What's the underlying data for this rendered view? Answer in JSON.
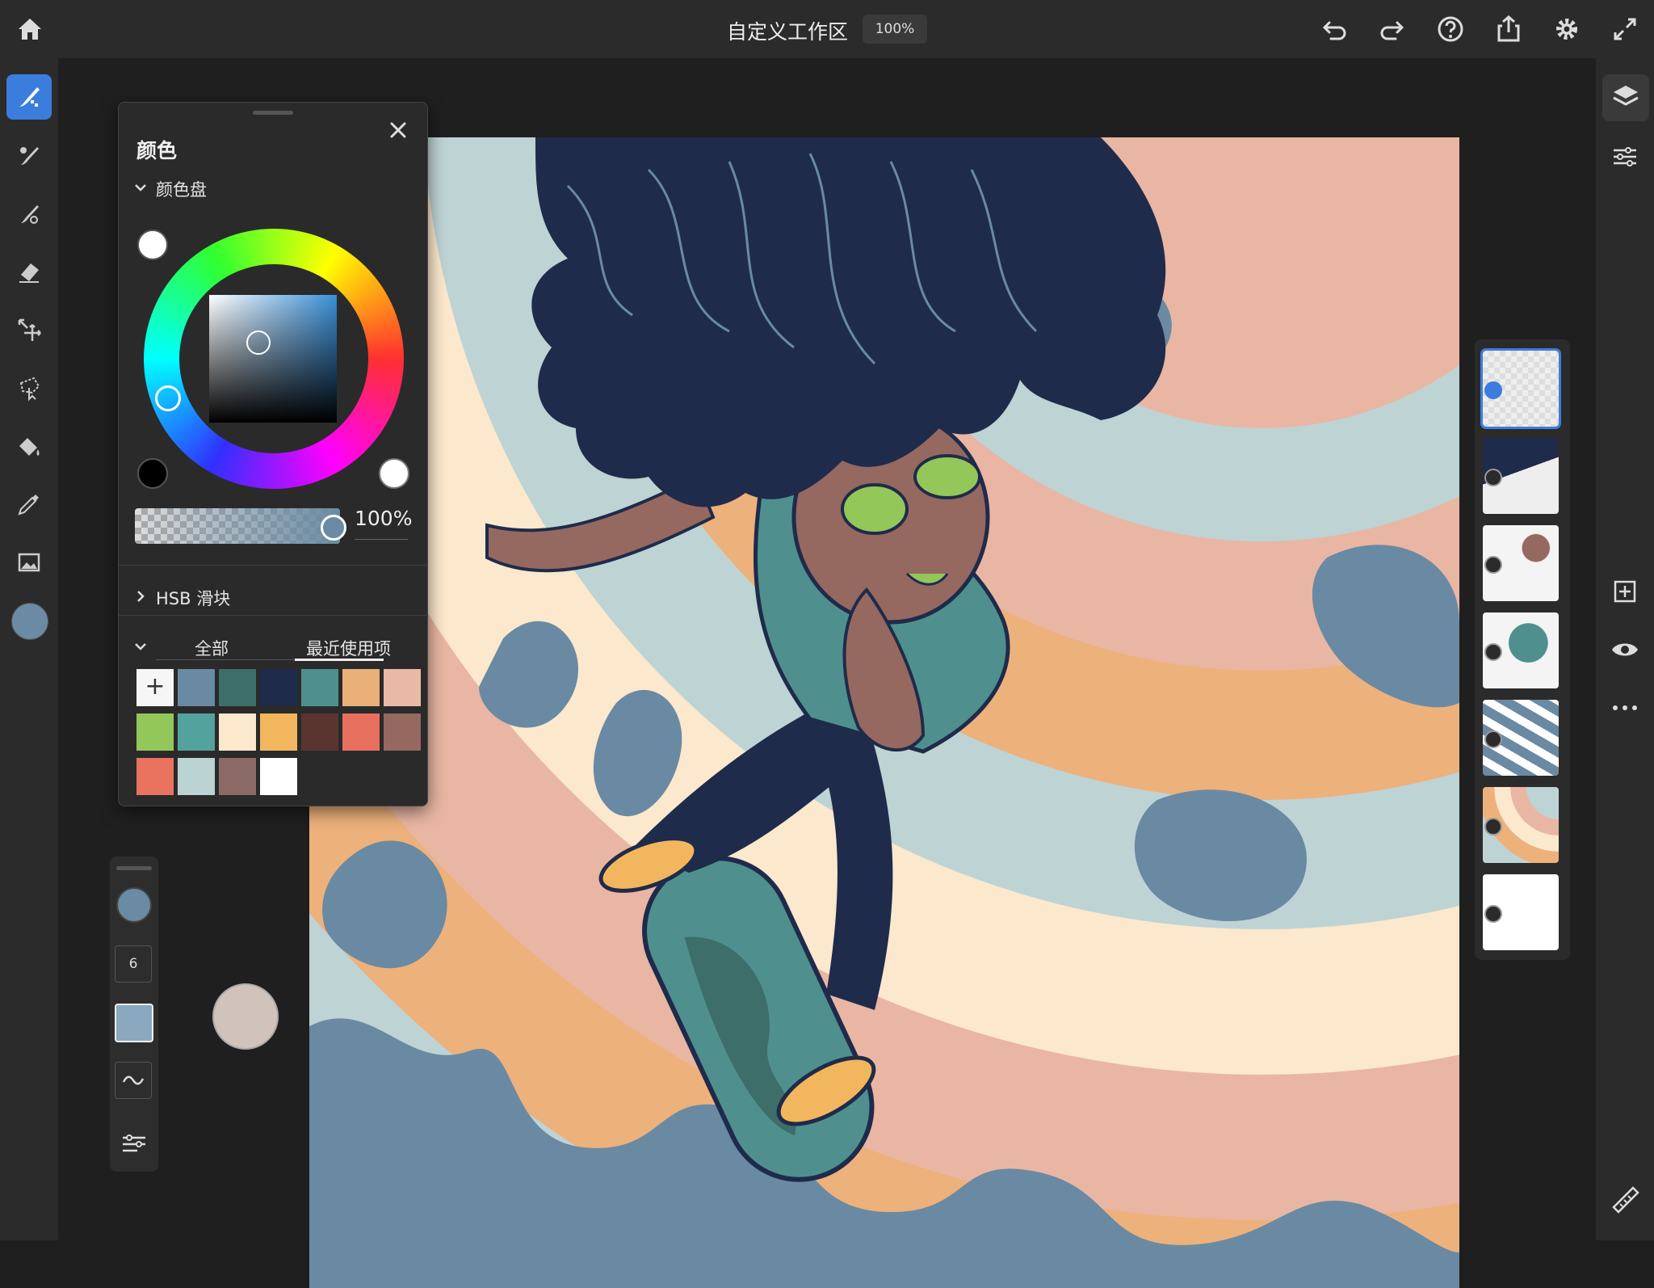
{
  "app": {
    "document_title": "自定义工作区",
    "zoom": "100%"
  },
  "toolbar_icons": [
    "home-icon",
    "undo-icon",
    "redo-icon",
    "help-icon",
    "share-icon",
    "settings-icon",
    "fullscreen-icon"
  ],
  "tools": [
    "pixel-brush",
    "live-brush",
    "vector-brush",
    "eraser",
    "transform",
    "selection",
    "fill",
    "eyedropper",
    "image-place"
  ],
  "color_panel": {
    "title": "颜色",
    "wheel_section": "颜色盘",
    "opacity": "100%",
    "hsb_section": "HSB 滑块",
    "tabs": [
      "全部",
      "最近使用项"
    ],
    "active_tab": "最近使用项",
    "add_label": "+",
    "current_color": "#6a8ba3",
    "swatches": [
      "#6a8aa3",
      "#3d6e6a",
      "#1f2b4a",
      "#4f908e",
      "#eab07a",
      "#eab9a5",
      "#93c75a",
      "#54a29d",
      "#fbe8cd",
      "#f2b65e",
      "#5a3530",
      "#e76f5e",
      "#956860",
      "#e9735f",
      "#bcd3d3",
      "#8b6a66",
      "#ffffff"
    ]
  },
  "brush_panel": {
    "size": "6",
    "brush_color": "#8aa8bf"
  },
  "layers": {
    "count": 7,
    "selected_index": 0
  },
  "colors": {
    "accent": "#3b7ddd",
    "chrome": "#2b2b2b"
  }
}
